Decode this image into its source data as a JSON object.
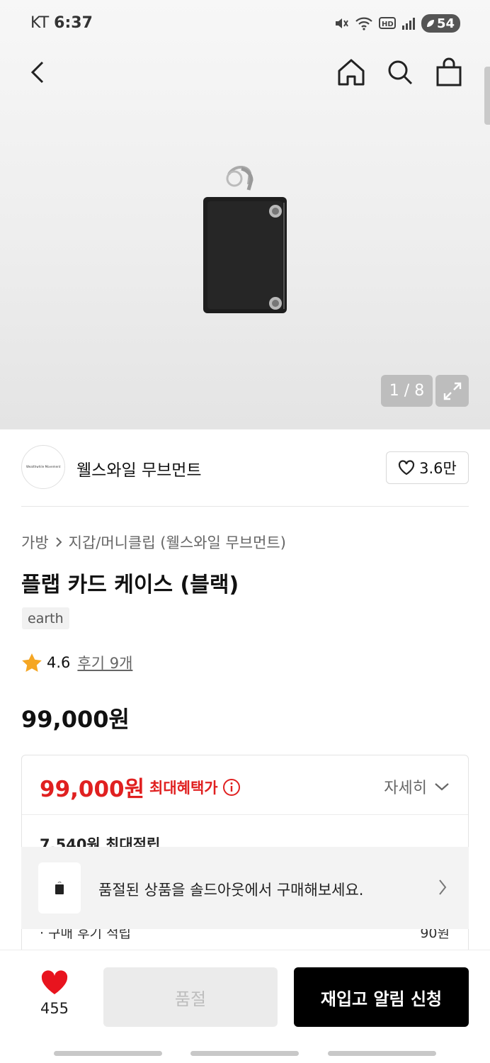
{
  "status_bar": {
    "carrier": "KT",
    "time": "6:37",
    "battery": "54"
  },
  "icons": {
    "back": "chevron-left-icon",
    "home": "home-icon",
    "search": "search-icon",
    "cart": "shopping-bag-icon",
    "expand": "expand-icon",
    "heart": "heart-icon",
    "star": "star-icon",
    "info": "info-icon",
    "chevron_down": "chevron-down-icon",
    "chevron_right": "chevron-right-icon"
  },
  "gallery": {
    "counter": "1 / 8"
  },
  "brand": {
    "name": "웰스와일 무브먼트",
    "logo_text": "Wealthwhile Movement",
    "likes": "3.6만"
  },
  "breadcrumb": {
    "category": "가방",
    "subcategory": "지갑/머니클립 (웰스와일 무브먼트)"
  },
  "product": {
    "title": "플랩 카드 케이스 (블랙)",
    "tag": "earth",
    "rating": "4.6",
    "reviews": "후기 9개",
    "price": "99,000원"
  },
  "benefit": {
    "price": "99,000원",
    "label": "최대혜택가",
    "detail": "자세히",
    "points": "7,540원 최대적립",
    "review_points_label": "· 구매 후기 적립",
    "review_points_value": "90원"
  },
  "soldout_banner": {
    "text": "품절된 상품을 솔드아웃에서 구매해보세요."
  },
  "bottom_bar": {
    "wish_count": "455",
    "soldout_label": "품절",
    "restock_label": "재입고 알림 신청"
  },
  "colors": {
    "accent_red": "#e02020",
    "primary_black": "#000000",
    "heart_red": "#e8141e"
  }
}
